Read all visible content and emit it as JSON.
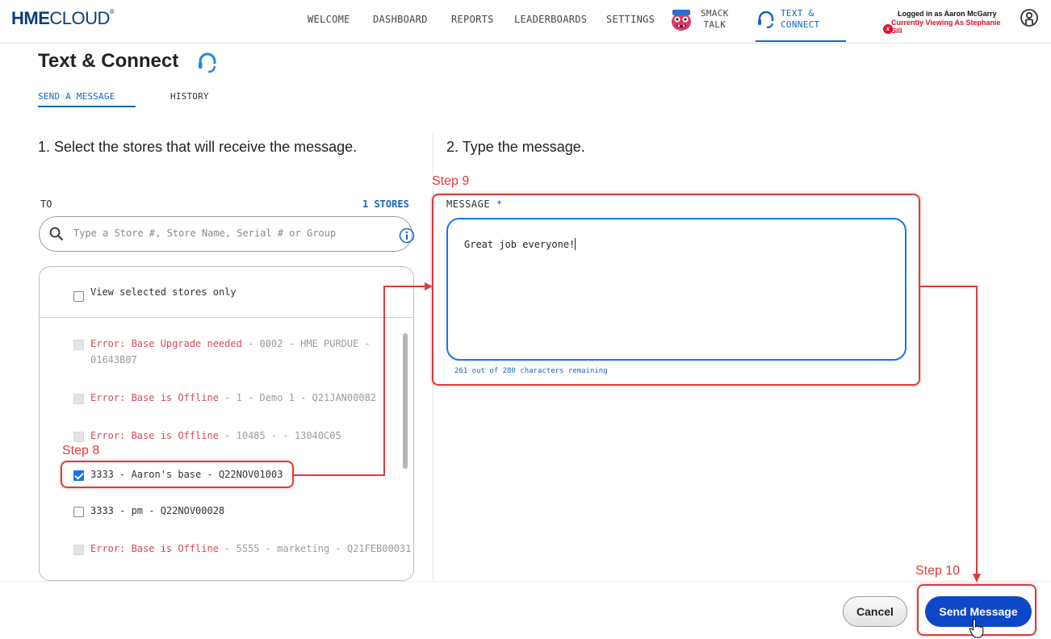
{
  "header": {
    "logo_bold": "HME",
    "logo_light": "CLOUD",
    "logo_reg": "®",
    "nav": {
      "welcome": "WELCOME",
      "dashboard": "DASHBOARD",
      "reports": "REPORTS",
      "leaderboards": "LEADERBOARDS",
      "settings": "SETTINGS",
      "smack_line1": "SMACK",
      "smack_line2": "TALK",
      "connect_line1": "TEXT &",
      "connect_line2": "CONNECT"
    },
    "logged_in": "Logged in as Aaron McGarry",
    "viewing_line1": "Currently Viewing As Stephanie",
    "viewing_line2": "Sill",
    "close_badge": "x"
  },
  "page": {
    "title": "Text & Connect",
    "tabs": {
      "send": "SEND A MESSAGE",
      "history": "HISTORY"
    }
  },
  "left": {
    "heading": "1. Select the stores that will receive the message.",
    "to_label": "TO",
    "stores_count": "1 STORES",
    "search_placeholder": "Type a Store #, Store Name, Serial # or Group",
    "view_selected": "View selected stores only",
    "stores": [
      {
        "error": "Error: Base Upgrade needed",
        "rest1": " - 0002 - HME PURDUE -",
        "rest2": "01643B07"
      },
      {
        "error": "Error: Base is Offline",
        "rest1": " - 1 - Demo 1 - Q21JAN00082"
      },
      {
        "error": "Error: Base is Offline",
        "rest1": " - 10485 - - 13040C05"
      },
      {
        "label": "3333 - Aaron's base - Q22NOV01003"
      },
      {
        "label": "3333 - pm - Q22NOV00028"
      },
      {
        "error": "Error: Base is Offline",
        "rest1": " - 5555 - marketing - Q21FEB00031"
      }
    ]
  },
  "right": {
    "heading": "2. Type the message.",
    "message_label": "MESSAGE",
    "required_mark": " *",
    "message_text": "Great job everyone!",
    "char_remaining": "261 out of 280 characters remaining"
  },
  "footer": {
    "cancel": "Cancel",
    "send": "Send Message"
  },
  "annotations": {
    "step8": "Step 8",
    "step9": "Step 9",
    "step10": "Step 10"
  },
  "colors": {
    "brand_blue": "#1565c0",
    "send_button": "#0d47c9",
    "annotation_red": "#e03a3a",
    "error_text": "#d94a5a"
  }
}
